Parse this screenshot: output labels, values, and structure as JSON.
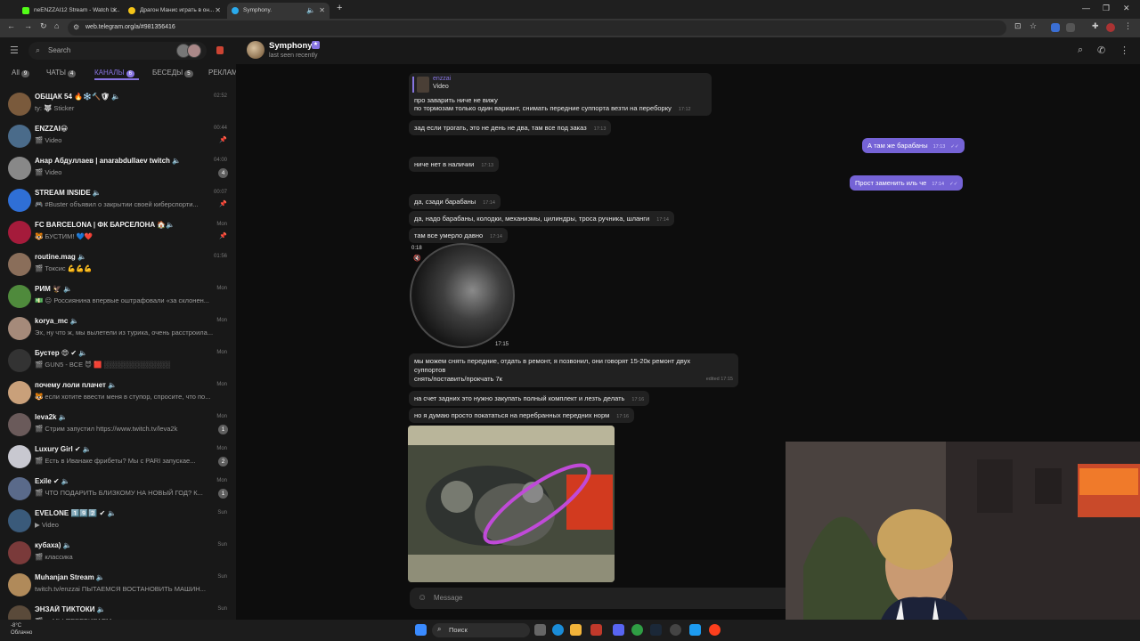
{
  "browser": {
    "tabs": [
      {
        "title": "neENZZAI12 Stream - Watch Li...",
        "color": "#53fc18"
      },
      {
        "title": "Драгон Манис играть в он...",
        "color": "#f5c518"
      },
      {
        "title": "Symphony.",
        "color": "#2aabee"
      }
    ],
    "url": "web.telegram.org/a/#981356416"
  },
  "telegram": {
    "search_placeholder": "Search",
    "folders": [
      {
        "label": "All",
        "count": "9"
      },
      {
        "label": "ЧАТЫ",
        "count": "4"
      },
      {
        "label": "КАНАЛЫ",
        "count": "6",
        "active": true
      },
      {
        "label": "БЕСЕДЫ",
        "count": "5"
      },
      {
        "label": "РЕКЛАМ",
        "count": ""
      }
    ],
    "chats": [
      {
        "name": "ОБЩАК 54 🔥❄️🔨🛡 🔈",
        "preview": "ty: 🐺 Sticker",
        "time": "02:52",
        "badge": "",
        "pin": false,
        "color": "#7a5a3c"
      },
      {
        "name": "ENZZAI😀",
        "preview": "🎬 Video",
        "time": "00:44",
        "badge": "",
        "pin": true,
        "color": "#4a6b8a"
      },
      {
        "name": "Анар Абдуллаев | anarabdullaev twitch 🔈",
        "preview": "🎬 Video",
        "time": "04:00",
        "badge": "4",
        "pin": false,
        "color": "#888"
      },
      {
        "name": "STREAM INSIDE 🔈",
        "preview": "🎮 #Buster объявил о закрытии своей киберспорти...",
        "time": "00:07",
        "badge": "",
        "pin": true,
        "color": "#2f6fd6"
      },
      {
        "name": "FC BARCELONA | ФК БАРСЕЛОНА 🏠🔈",
        "preview": "🐯 БУСТИМ! 💙❤️",
        "time": "Mon",
        "badge": "",
        "pin": true,
        "color": "#a51b3b"
      },
      {
        "name": "routine.mag 🔈",
        "preview": "🎬 Токсис 💪💪💪",
        "time": "01:56",
        "badge": "",
        "pin": false,
        "color": "#8a6e5a"
      },
      {
        "name": "РИМ 🦅 🔈",
        "preview": "💵 😐 Россиянина впервые оштрафовали «за склонен...",
        "time": "Mon",
        "badge": "",
        "pin": false,
        "color": "#4f8a3c"
      },
      {
        "name": "korya_mc 🔈",
        "preview": "Эх, ну что ж, мы вылетели из турика, очень расстроила...",
        "time": "Mon",
        "badge": "",
        "pin": false,
        "color": "#a58a7a"
      },
      {
        "name": "Бустер 😍 ✔ 🔈",
        "preview": "🎬 GUN5 - ВСЕ 😈 🟥 ░░░░░░░░░░░░░░",
        "time": "Mon",
        "badge": "",
        "pin": false,
        "color": "#333"
      },
      {
        "name": "почему лоли плачет 🔈",
        "preview": "🐯 если хотите ввести меня в ступор, спросите, что по...",
        "time": "Mon",
        "badge": "",
        "pin": false,
        "color": "#c9a07a"
      },
      {
        "name": "leva2k 🔈",
        "preview": "🎬 Стрим запустил https://www.twitch.tv/leva2k",
        "time": "Mon",
        "badge": "1",
        "pin": false,
        "color": "#6a5a5a"
      },
      {
        "name": "Luxury Girl ✔ 🔈",
        "preview": "🎬 Есть в Иванаке фрибеты? Мы с PARI запускае...",
        "time": "Mon",
        "badge": "2",
        "pin": false,
        "color": "#c8c8d0"
      },
      {
        "name": "Exile ✔ 🔈",
        "preview": "🎬 ЧТО ПОДАРИТЬ БЛИЗКОМУ НА НОВЫЙ ГОД? К...",
        "time": "Mon",
        "badge": "1",
        "pin": false,
        "color": "#5a6a8a"
      },
      {
        "name": "EVELONE 1️⃣9️⃣2️⃣ ✔ 🔈",
        "preview": "▶ Video",
        "time": "Sun",
        "badge": "",
        "pin": false,
        "color": "#3a5a7a"
      },
      {
        "name": "кубаха) 🔈",
        "preview": "🎬 классика",
        "time": "Sun",
        "badge": "",
        "pin": false,
        "color": "#7a3a3a"
      },
      {
        "name": "Muhanjan Stream 🔈",
        "preview": "twitch.tv/enzzai ПЫТАЕМСЯ ВОСТАНОВИТЬ МАШИН...",
        "time": "Sun",
        "badge": "",
        "pin": false,
        "color": "#b08a5a"
      },
      {
        "name": "ЭНЗАЙ ТИКТОКИ 🔈",
        "preview": "🎬 ... МЫ ПЕРЕБИРАЕМ ...",
        "time": "Sun",
        "badge": "",
        "pin": false,
        "color": "#5a4a3a"
      }
    ],
    "peer": {
      "name": "Symphony.",
      "status": "last seen recently"
    },
    "reply": {
      "name": "enzzai",
      "text": "Video"
    },
    "messages": [
      {
        "text": "про заварить ниче не вижу",
        "time": ""
      },
      {
        "text": "по тормозам только один вариант, снимать передние суппорта везти на переборку",
        "time": "17:12"
      },
      {
        "text": "зад если трогать, это не день не два, там все под заказ",
        "time": "17:13"
      },
      {
        "text": "ниче нет в наличии",
        "time": "17:13"
      },
      {
        "text": "да, сзади барабаны",
        "time": "17:14"
      },
      {
        "text": "да, надо барабаны, колодки, механизмы, цилиндры, троса ручника, шланги",
        "time": "17:14"
      },
      {
        "text": "там все умерло давно",
        "time": "17:14"
      },
      {
        "text": "мы можем снять передние, отдать в ремонт, я позвонил, они говорят 15-20к ремонт двух",
        "time": ""
      },
      {
        "text": "суппортов",
        "time": ""
      },
      {
        "text": "снять/поставить/прокчать 7к",
        "time": "edited 17:15"
      },
      {
        "text": "на счет задних это нужно закупать полный комплект и лезть делать",
        "time": "17:16"
      },
      {
        "text": "но я думаю просто покататься на перебранных передних норм",
        "time": "17:16"
      }
    ],
    "outgoing": [
      {
        "text": "А там же барабаны",
        "time": "17:13"
      },
      {
        "text": "Прост заменить иль че",
        "time": "17:14"
      }
    ],
    "video_duration": "0:18",
    "video_time": "17:15",
    "composer_placeholder": "Message"
  },
  "taskbar": {
    "weather_temp": "-8°C",
    "weather_desc": "Облачно",
    "search": "Поиск"
  }
}
